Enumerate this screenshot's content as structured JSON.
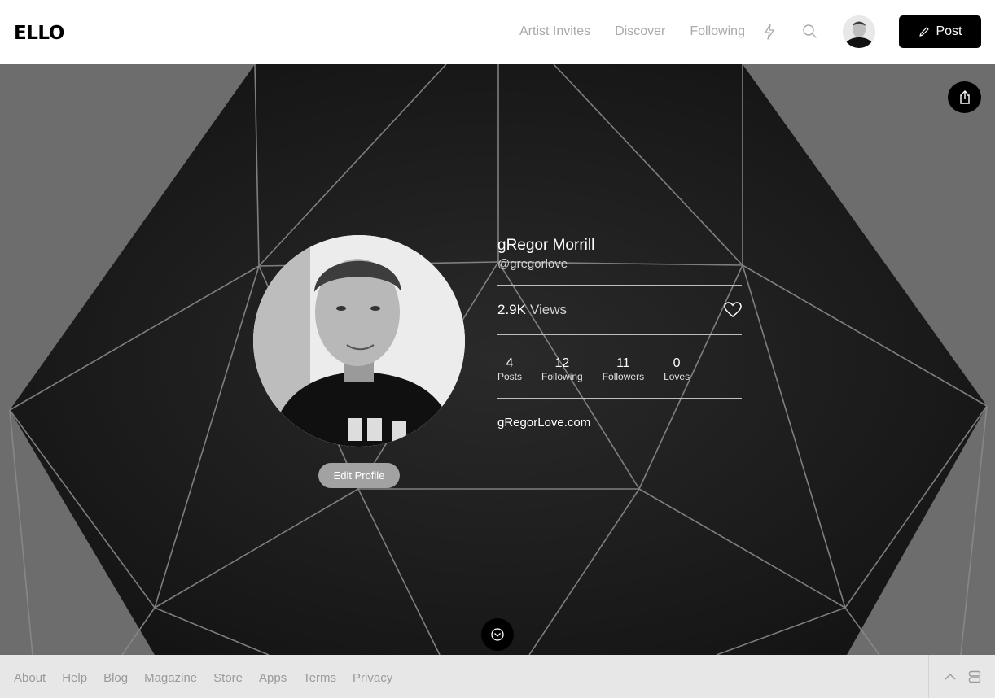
{
  "header": {
    "logo": "ELLO",
    "nav": [
      "Artist Invites",
      "Discover",
      "Following"
    ],
    "icons": [
      "bolt-icon",
      "search-icon"
    ],
    "post_label": "Post"
  },
  "profile": {
    "name": "gRegor Morrill",
    "handle": "@gregorlove",
    "views_count": "2.9K",
    "views_label": "Views",
    "stats": [
      {
        "value": "4",
        "label": "Posts"
      },
      {
        "value": "12",
        "label": "Following"
      },
      {
        "value": "11",
        "label": "Followers"
      },
      {
        "value": "0",
        "label": "Loves"
      }
    ],
    "website": "gRegorLove.com",
    "edit_label": "Edit Profile"
  },
  "footer": {
    "links": [
      "About",
      "Help",
      "Blog",
      "Magazine",
      "Store",
      "Apps",
      "Terms",
      "Privacy"
    ]
  },
  "colors": {
    "accent": "#000000",
    "nav_text": "#aaaaaa",
    "footer_bg": "#e7e7e7",
    "hero_bg": "#1f1f1f"
  }
}
